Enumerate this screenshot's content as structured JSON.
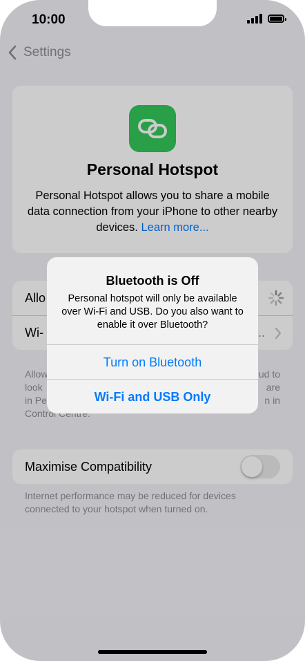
{
  "status_bar": {
    "time": "10:00"
  },
  "nav": {
    "back_label": "Settings"
  },
  "hero": {
    "title": "Personal Hotspot",
    "description": "Personal Hotspot allows you to share a mobile data connection from your iPhone to other nearby devices.",
    "learn_more": "Learn more..."
  },
  "settings_group": {
    "row1_label": "Allo",
    "row2_label": "Wi-",
    "row2_value": ".."
  },
  "footnote_hidden": {
    "line1_left": "Allow",
    "line1_right": "ud to",
    "line2_left": "look",
    "line2_right": "are",
    "line3_left": "in Pe",
    "line3_right": "n in",
    "line4_left": "Control Centre."
  },
  "compatibility": {
    "label": "Maximise Compatibility",
    "enabled": false,
    "footnote": "Internet performance may be reduced for devices connected to your hotspot when turned on."
  },
  "alert": {
    "title": "Bluetooth is Off",
    "message": "Personal hotspot will only be available over Wi-Fi and USB. Do you also want to enable it over Bluetooth?",
    "button_primary": "Turn on Bluetooth",
    "button_secondary": "Wi-Fi and USB Only"
  },
  "colors": {
    "accent": "#007aff",
    "app_icon": "#34c759",
    "background": "#f2f2f7"
  },
  "icons": {
    "app": "link-icon",
    "back": "chevron-left-icon",
    "loading": "spinner-icon",
    "disclosure": "chevron-right-icon"
  }
}
